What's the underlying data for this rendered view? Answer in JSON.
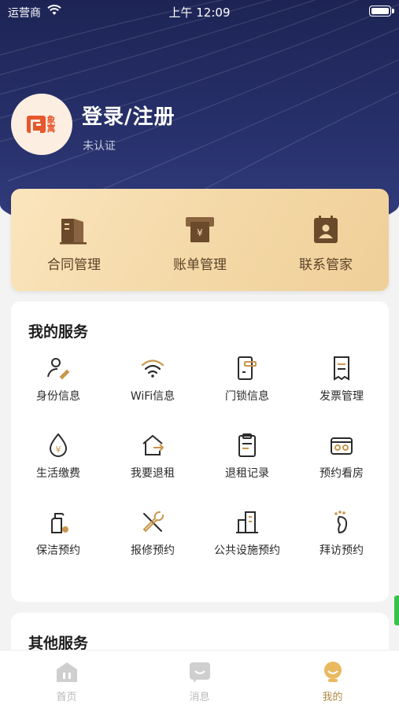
{
  "status_bar": {
    "carrier": "运营商",
    "time": "上午 12:09"
  },
  "profile": {
    "title": "登录/注册",
    "certification": "未认证",
    "logo_text": "象寓"
  },
  "quick_actions": [
    {
      "label": "合同管理",
      "icon": "contract-icon"
    },
    {
      "label": "账单管理",
      "icon": "bill-icon"
    },
    {
      "label": "联系管家",
      "icon": "contact-icon"
    }
  ],
  "my_services": {
    "title": "我的服务",
    "items": [
      {
        "label": "身份信息",
        "icon": "identity-icon"
      },
      {
        "label": "WiFi信息",
        "icon": "wifi-icon"
      },
      {
        "label": "门锁信息",
        "icon": "door-lock-icon"
      },
      {
        "label": "发票管理",
        "icon": "invoice-icon"
      },
      {
        "label": "生活缴费",
        "icon": "utility-payment-icon"
      },
      {
        "label": "我要退租",
        "icon": "move-out-icon"
      },
      {
        "label": "退租记录",
        "icon": "move-out-record-icon"
      },
      {
        "label": "预约看房",
        "icon": "viewing-icon"
      },
      {
        "label": "保洁预约",
        "icon": "cleaning-icon"
      },
      {
        "label": "报修预约",
        "icon": "repair-icon"
      },
      {
        "label": "公共设施预约",
        "icon": "public-facility-icon"
      },
      {
        "label": "拜访预约",
        "icon": "visit-icon"
      }
    ]
  },
  "other_services": {
    "title": "其他服务"
  },
  "tabbar": {
    "items": [
      {
        "label": "首页",
        "icon": "home-icon",
        "active": false
      },
      {
        "label": "消息",
        "icon": "message-icon",
        "active": false
      },
      {
        "label": "我的",
        "icon": "profile-icon",
        "active": true
      }
    ]
  },
  "colors": {
    "hero_bg": "#27306a",
    "gold_card": "#f4d9a8",
    "active_tab": "#b08a45",
    "brand": "#e5572c"
  }
}
